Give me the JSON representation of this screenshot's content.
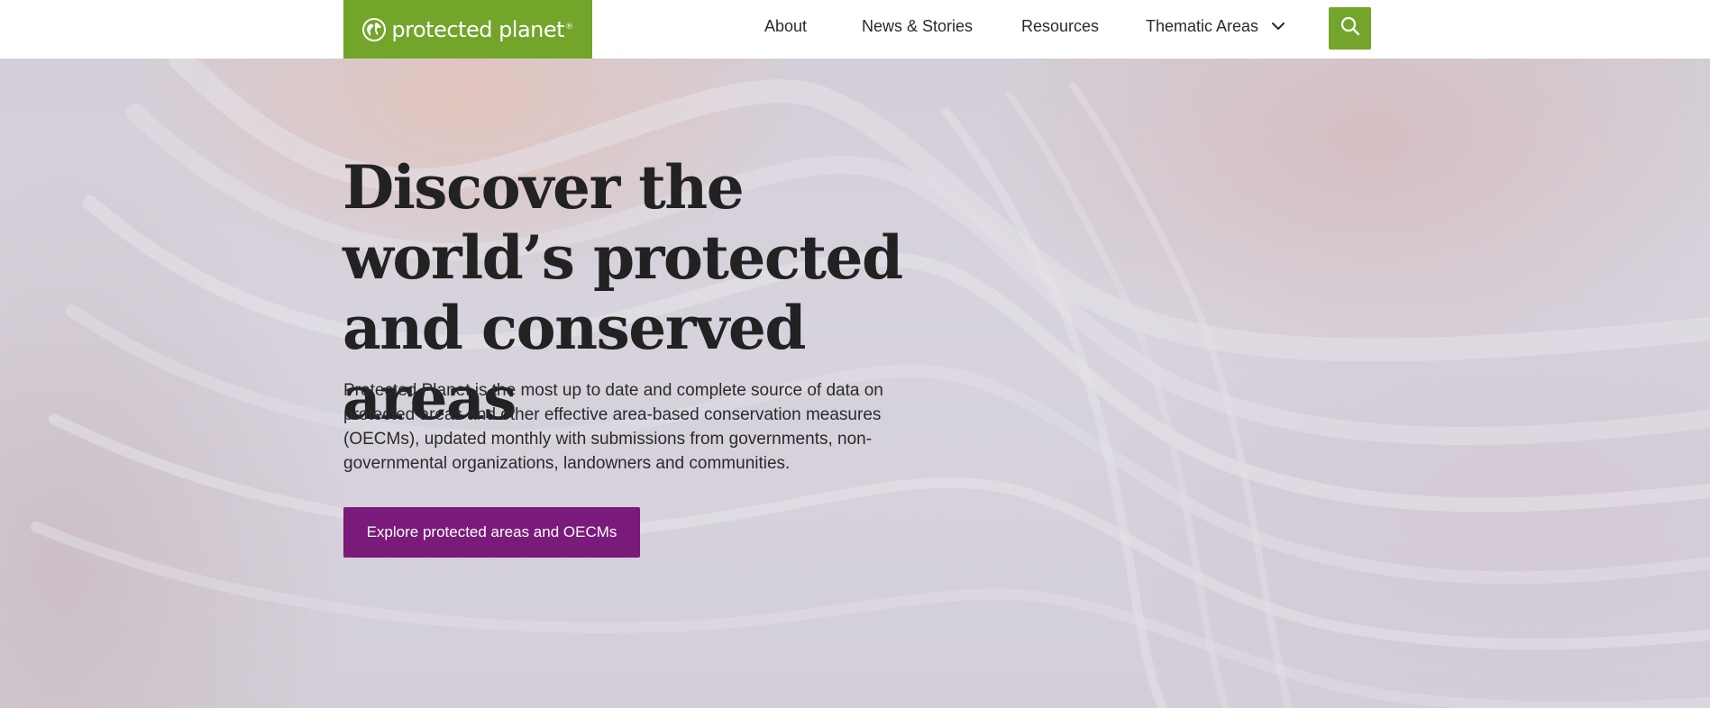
{
  "header": {
    "logo_text": "protected planet",
    "logo_reg": "®",
    "nav": [
      {
        "label": "About"
      },
      {
        "label": "News & Stories"
      },
      {
        "label": "Resources"
      },
      {
        "label": "Thematic Areas"
      }
    ],
    "search_icon": "search-icon",
    "dropdown_icon": "chevron-down-icon"
  },
  "hero": {
    "title": "Discover the world’s protected and conserved areas",
    "description": "Protected Planet is the most up to date and complete source of data on protected areas and other effective area-based conservation measures (OECMs), updated monthly with submissions from governments, non-governmental organizations, landowners and communities.",
    "cta_label": "Explore protected areas and OECMs"
  },
  "colors": {
    "brand_green": "#72a52a",
    "cta_purple": "#7a1a7a",
    "text_dark": "#222222"
  }
}
